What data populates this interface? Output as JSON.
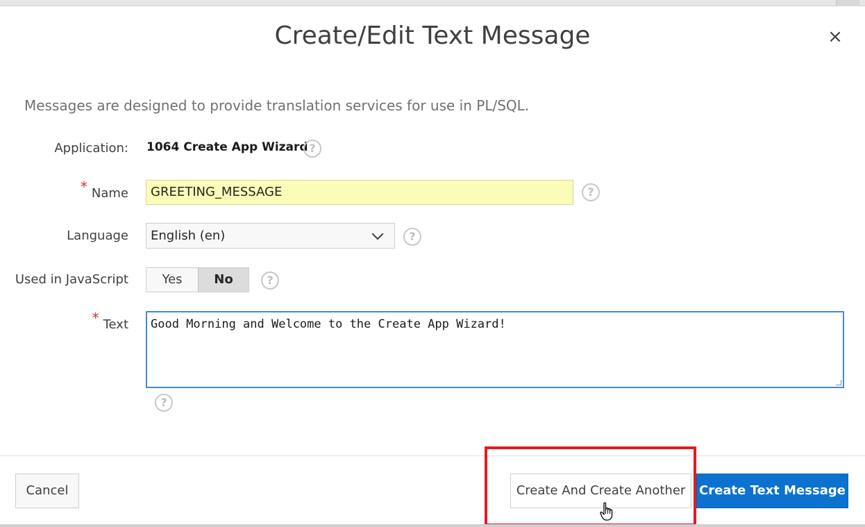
{
  "dialog": {
    "title": "Create/Edit Text Message",
    "close_label": "×",
    "intro": "Messages are designed to provide translation services for use in PL/SQL."
  },
  "form": {
    "application": {
      "label": "Application:",
      "value": "1064 Create App Wizard"
    },
    "name": {
      "label": "Name",
      "required_mark": "*",
      "value": "GREETING_MESSAGE"
    },
    "language": {
      "label": "Language",
      "selected": "English (en)"
    },
    "used_in_javascript": {
      "label": "Used in JavaScript",
      "options": [
        "Yes",
        "No"
      ],
      "selected": "No"
    },
    "text": {
      "label": "Text",
      "required_mark": "*",
      "value": "Good Morning and Welcome to the Create App Wizard!"
    },
    "help_glyph": "?"
  },
  "footer": {
    "cancel_label": "Cancel",
    "create_another_label": "Create And Create Another",
    "create_label": "Create Text Message"
  },
  "colors": {
    "primary_button": "#0b72d0",
    "required_star": "#e22d26",
    "highlight_box": "#e21b23",
    "name_field_bg": "#fbfcb7",
    "textarea_focus_border": "#3e8bd5"
  },
  "icons": {
    "close": "close-icon",
    "help": "help-icon",
    "select_arrow": "chevron-down-icon",
    "pointer": "hand-pointer-icon"
  }
}
